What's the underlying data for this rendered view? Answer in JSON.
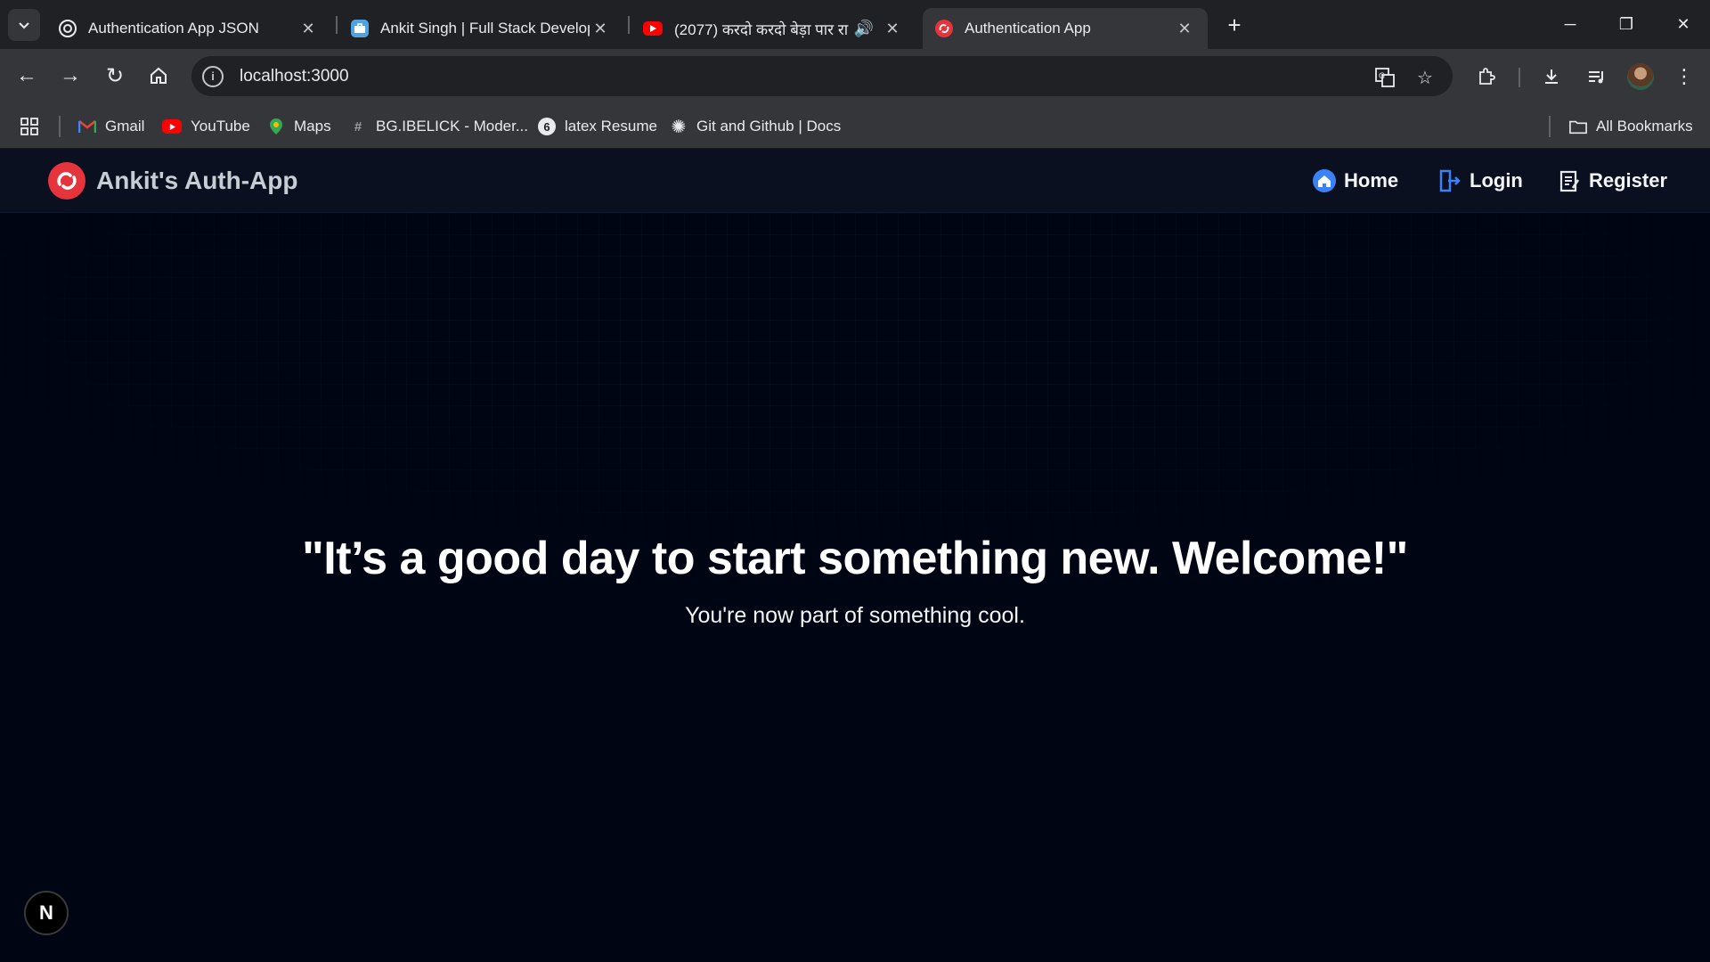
{
  "browser": {
    "tabs": [
      {
        "title": "Authentication App JSON",
        "favicon": "chatgpt-icon"
      },
      {
        "title": "Ankit Singh | Full Stack Develop",
        "favicon": "briefcase-icon"
      },
      {
        "title": "(2077) करदो करदो बेड़ा पार रा",
        "favicon": "youtube-icon"
      },
      {
        "title": "Authentication App",
        "favicon": "auth-app-icon"
      }
    ],
    "url": "localhost:3000",
    "bookmarks": [
      {
        "label": "Gmail",
        "icon": "gmail-icon"
      },
      {
        "label": "YouTube",
        "icon": "youtube-icon"
      },
      {
        "label": "Maps",
        "icon": "maps-icon"
      },
      {
        "label": "BG.IBELICK - Moder...",
        "icon": "hash-icon"
      },
      {
        "label": "latex Resume",
        "icon": "overleaf-icon"
      },
      {
        "label": "Git and Github | Docs",
        "icon": "gear-icon"
      }
    ],
    "all_bookmarks": "All Bookmarks"
  },
  "app": {
    "brand": "Ankit's Auth-App",
    "nav": {
      "home": "Home",
      "login": "Login",
      "register": "Register"
    },
    "headline": "\"It’s a good day to start something new. Welcome!\"",
    "subline": "You're now part of something cool.",
    "dev_badge": "N"
  },
  "colors": {
    "page_bg": "#000514",
    "navbar_bg": "#0a1020",
    "brand_red": "#e5343b",
    "link_blue": "#3b82f6"
  }
}
